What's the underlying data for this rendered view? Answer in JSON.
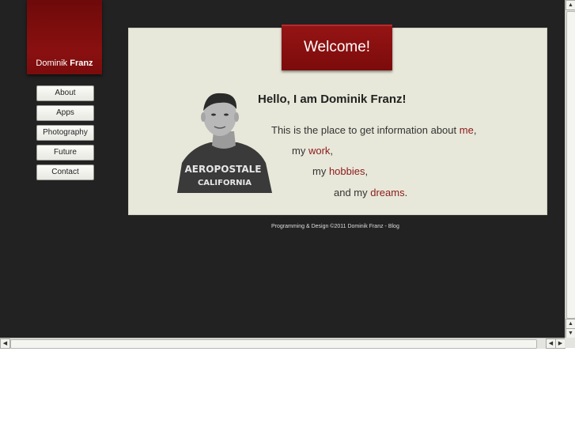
{
  "logo": {
    "first": "Dominik",
    "last": "Franz"
  },
  "nav": [
    "About",
    "Apps",
    "Photography",
    "Future",
    "Contact"
  ],
  "welcome": "Welcome!",
  "headline": "Hello, I am Dominik Franz!",
  "lines": {
    "l1_text": "This is the place to get information about ",
    "l1_link": "me",
    "l1_end": ",",
    "l2_text": "my ",
    "l2_link": "work",
    "l2_end": ",",
    "l3_text": "my ",
    "l3_link": "hobbies",
    "l3_end": ",",
    "l4_text": "and my ",
    "l4_link": "dreams",
    "l4_end": "."
  },
  "photo": {
    "shirt_text_1": "AEROPOSTALE",
    "shirt_text_2": "CALIFORNIA"
  },
  "footer": {
    "copyright": "Programming & Design ©2011 Dominik Franz",
    "separator": " - ",
    "blog": "Blog"
  },
  "colors": {
    "background": "#222222",
    "accent": "#8b1a1a",
    "panel": "#e8e8da"
  }
}
